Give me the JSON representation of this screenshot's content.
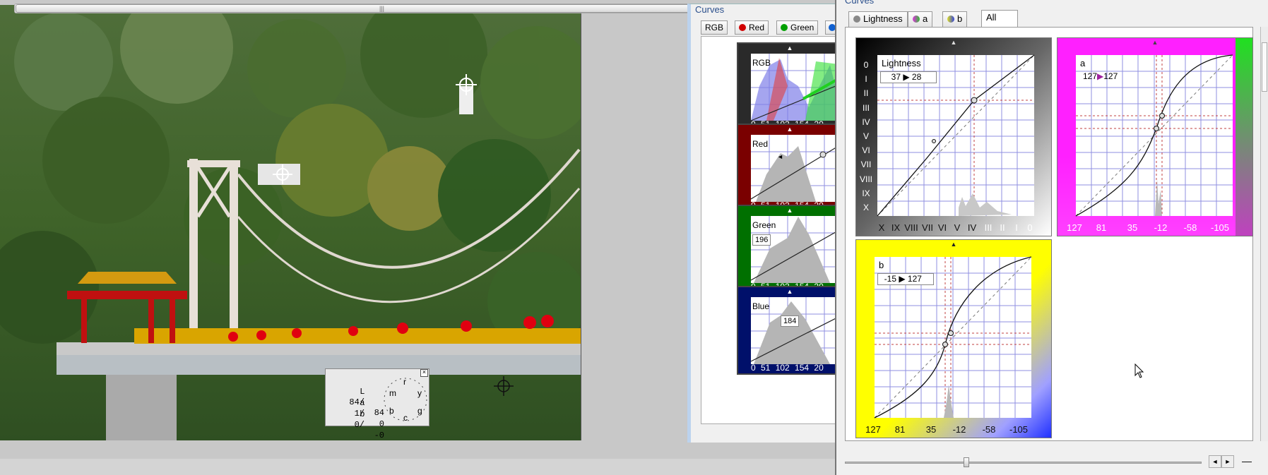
{
  "info_panel": {
    "rows": [
      {
        "ch": "L",
        "a": "84/",
        "b": "84"
      },
      {
        "ch": "a",
        "a": "1/",
        "b": "0"
      },
      {
        "ch": "b",
        "a": "0/",
        "b": "-0"
      }
    ],
    "dial_labels": [
      "m",
      "r",
      "y",
      "g",
      "c",
      "b"
    ],
    "close": "×"
  },
  "small_curves": {
    "title": "Curves",
    "tabs": [
      "RGB",
      "Red",
      "Green"
    ],
    "tab_colors": [
      "#ffffff",
      "#d00000",
      "#00a000",
      "#1060d0"
    ],
    "panels": [
      {
        "label": "RGB",
        "bg": "#303030",
        "ticks": "0 51 102 154 20"
      },
      {
        "label": "Red",
        "bg": "#7a0000",
        "ticks": "0 51 102 154 20",
        "marker": "◄"
      },
      {
        "label": "Green",
        "bg": "#007000",
        "ticks": "0 51 102 154 20",
        "value": "196"
      },
      {
        "label": "Blue",
        "bg": "#00106a",
        "ticks": "0 51 102 154 20",
        "value": "184"
      }
    ]
  },
  "big_curves": {
    "title": "Curves",
    "tabs": [
      "Lightness",
      "a",
      "b",
      "All"
    ],
    "active_tab": "All",
    "lightness": {
      "label": "Lightness",
      "from": "37",
      "to": "28",
      "y_ticks": [
        "0",
        "I",
        "II",
        "III",
        "IV",
        "V",
        "VI",
        "VII",
        "VIII",
        "IX",
        "X"
      ],
      "x_ticks": [
        "X",
        "IX",
        "VIII",
        "VII",
        "VI",
        "V",
        "IV",
        "III",
        "II",
        "I",
        "0"
      ]
    },
    "a": {
      "label": "a",
      "from": "127",
      "to": "127",
      "x_ticks": [
        "127",
        "81",
        "35",
        "-12",
        "-58",
        "-105"
      ]
    },
    "b": {
      "label": "b",
      "from": "-15",
      "to": "127",
      "x_ticks": [
        "127",
        "81",
        "35",
        "-12",
        "-58",
        "-105"
      ]
    },
    "nav": {
      "left": "◄",
      "right": "►",
      "dash": "—"
    }
  },
  "scroll": {
    "grip": "|||",
    "arrow": "►"
  },
  "colors": {
    "accent": "#2a4f8c",
    "grid": "#8f8fe0",
    "magenta": "#ff20ff",
    "yellow": "#ffff00",
    "blue": "#0010ff"
  }
}
